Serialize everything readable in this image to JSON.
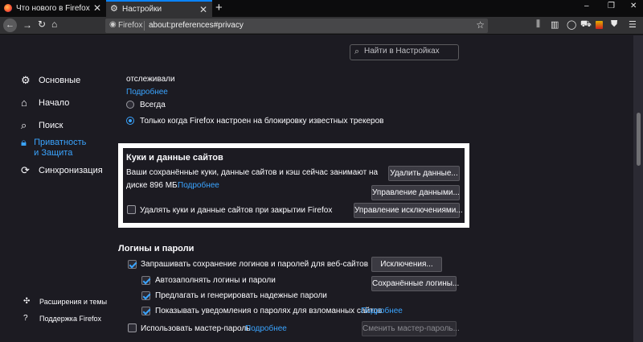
{
  "tabs": [
    {
      "title": "Что нового в Firefox",
      "active": false
    },
    {
      "title": "Настройки",
      "active": true
    }
  ],
  "newtab_symbol": "+",
  "window_controls": [
    "–",
    "❐",
    "✕"
  ],
  "urlbar": {
    "identity": "Firefox",
    "url": "about:preferences#privacy"
  },
  "search": {
    "placeholder": "Найти в Настройках"
  },
  "sidebar": {
    "items": [
      {
        "label": "Основные",
        "icon": "gear-icon",
        "active": false
      },
      {
        "label": "Начало",
        "icon": "home-icon",
        "active": false
      },
      {
        "label": "Поиск",
        "icon": "search-icon",
        "active": false
      },
      {
        "label": "Приватность и Защита",
        "icon": "lock-icon",
        "active": true
      },
      {
        "label": "Синхронизация",
        "icon": "sync-icon",
        "active": false
      }
    ],
    "footer": [
      {
        "label": "Расширения и темы",
        "icon": "puzzle-icon"
      },
      {
        "label": "Поддержка Firefox",
        "icon": "help-icon"
      }
    ]
  },
  "tracking": {
    "text_top": "отслеживали",
    "learn_more": "Подробнее",
    "option_always": "Всегда",
    "option_only": "Только когда Firefox настроен на блокировку известных трекеров",
    "selected": "only"
  },
  "cookies": {
    "heading": "Куки и данные сайтов",
    "desc_line1": "Ваши сохранённые куки, данные сайтов и кэш сейчас занимают на",
    "desc_line2": "диске 896 МБ.",
    "learn_more": "Подробнее",
    "btn_clear": "Удалить данные...",
    "btn_manage": "Управление данными...",
    "btn_exceptions": "Управление исключениями...",
    "delete_on_close": "Удалять куки и данные сайтов при закрытии Firefox",
    "delete_on_close_checked": false
  },
  "logins": {
    "heading": "Логины и пароли",
    "ask_save": "Запрашивать сохранение логинов и паролей для веб-сайтов",
    "ask_save_checked": true,
    "autofill": "Автозаполнять логины и пароли",
    "autofill_checked": true,
    "suggest": "Предлагать и генерировать надежные пароли",
    "suggest_checked": true,
    "breach": "Показывать уведомления о паролях для взломанных сайтов",
    "breach_checked": true,
    "breach_learn_more": "Подробнее",
    "master": "Использовать мастер-пароль",
    "master_checked": false,
    "master_learn_more": "Подробнее",
    "btn_exceptions": "Исключения...",
    "btn_saved": "Сохранённые логины...",
    "btn_change_master": "Сменить мастер-пароль..."
  }
}
